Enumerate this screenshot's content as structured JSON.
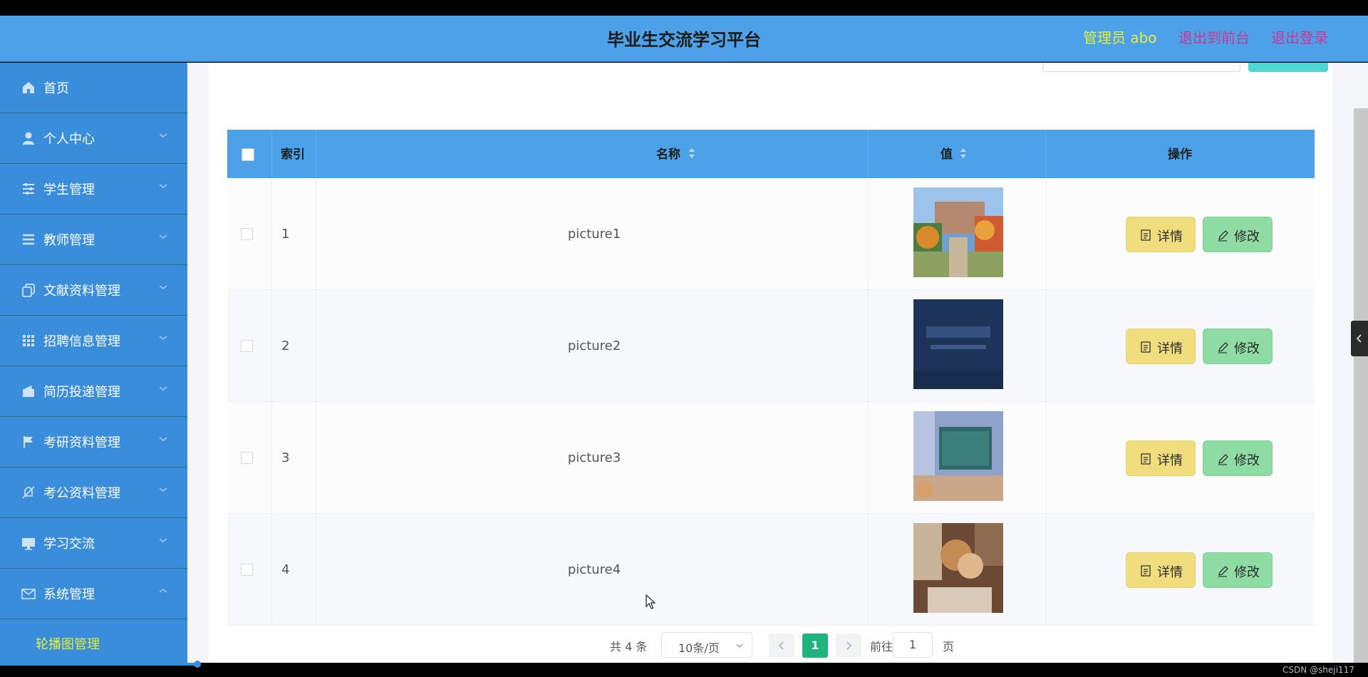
{
  "header": {
    "title": "毕业生交流学习平台",
    "user_label": "管理员 abo",
    "exit_front": "退出到前台",
    "logout": "退出登录"
  },
  "sidebar": {
    "items": [
      {
        "label": "首页",
        "icon": "home-icon"
      },
      {
        "label": "个人中心",
        "icon": "user-icon"
      },
      {
        "label": "学生管理",
        "icon": "sliders-icon"
      },
      {
        "label": "教师管理",
        "icon": "list-icon"
      },
      {
        "label": "文献资料管理",
        "icon": "copy-icon"
      },
      {
        "label": "招聘信息管理",
        "icon": "grid-icon"
      },
      {
        "label": "简历投递管理",
        "icon": "wallet-icon"
      },
      {
        "label": "考研资料管理",
        "icon": "flag-icon"
      },
      {
        "label": "考公资料管理",
        "icon": "bell-off-icon"
      },
      {
        "label": "学习交流",
        "icon": "monitor-icon"
      },
      {
        "label": "系统管理",
        "icon": "mail-icon"
      }
    ],
    "sub_item": "轮播图管理"
  },
  "table": {
    "headers": {
      "index": "索引",
      "name": "名称",
      "value": "值",
      "action": "操作"
    },
    "rows": [
      {
        "index": "1",
        "name": "picture1",
        "thumb": "campus-photo"
      },
      {
        "index": "2",
        "name": "picture2",
        "thumb": "dark-banner"
      },
      {
        "index": "3",
        "name": "picture3",
        "thumb": "classroom-photo"
      },
      {
        "index": "4",
        "name": "picture4",
        "thumb": "students-photo"
      }
    ],
    "detail_label": "详情",
    "edit_label": "修改"
  },
  "pagination": {
    "total": "共 4 条",
    "page_size": "10条/页",
    "current": "1",
    "goto_prefix": "前往",
    "goto_value": "1",
    "goto_suffix": "页"
  },
  "watermark": "CSDN @sheji117",
  "colors": {
    "header_bg": "#4ca1e9",
    "sidebar_bg": "#3a8ddb",
    "accent_yellow": "#e5ee38",
    "accent_magenta": "#c73a93",
    "detail_btn": "#f0de7e",
    "edit_btn": "#8fdba4",
    "pager_active": "#1fb37e"
  }
}
